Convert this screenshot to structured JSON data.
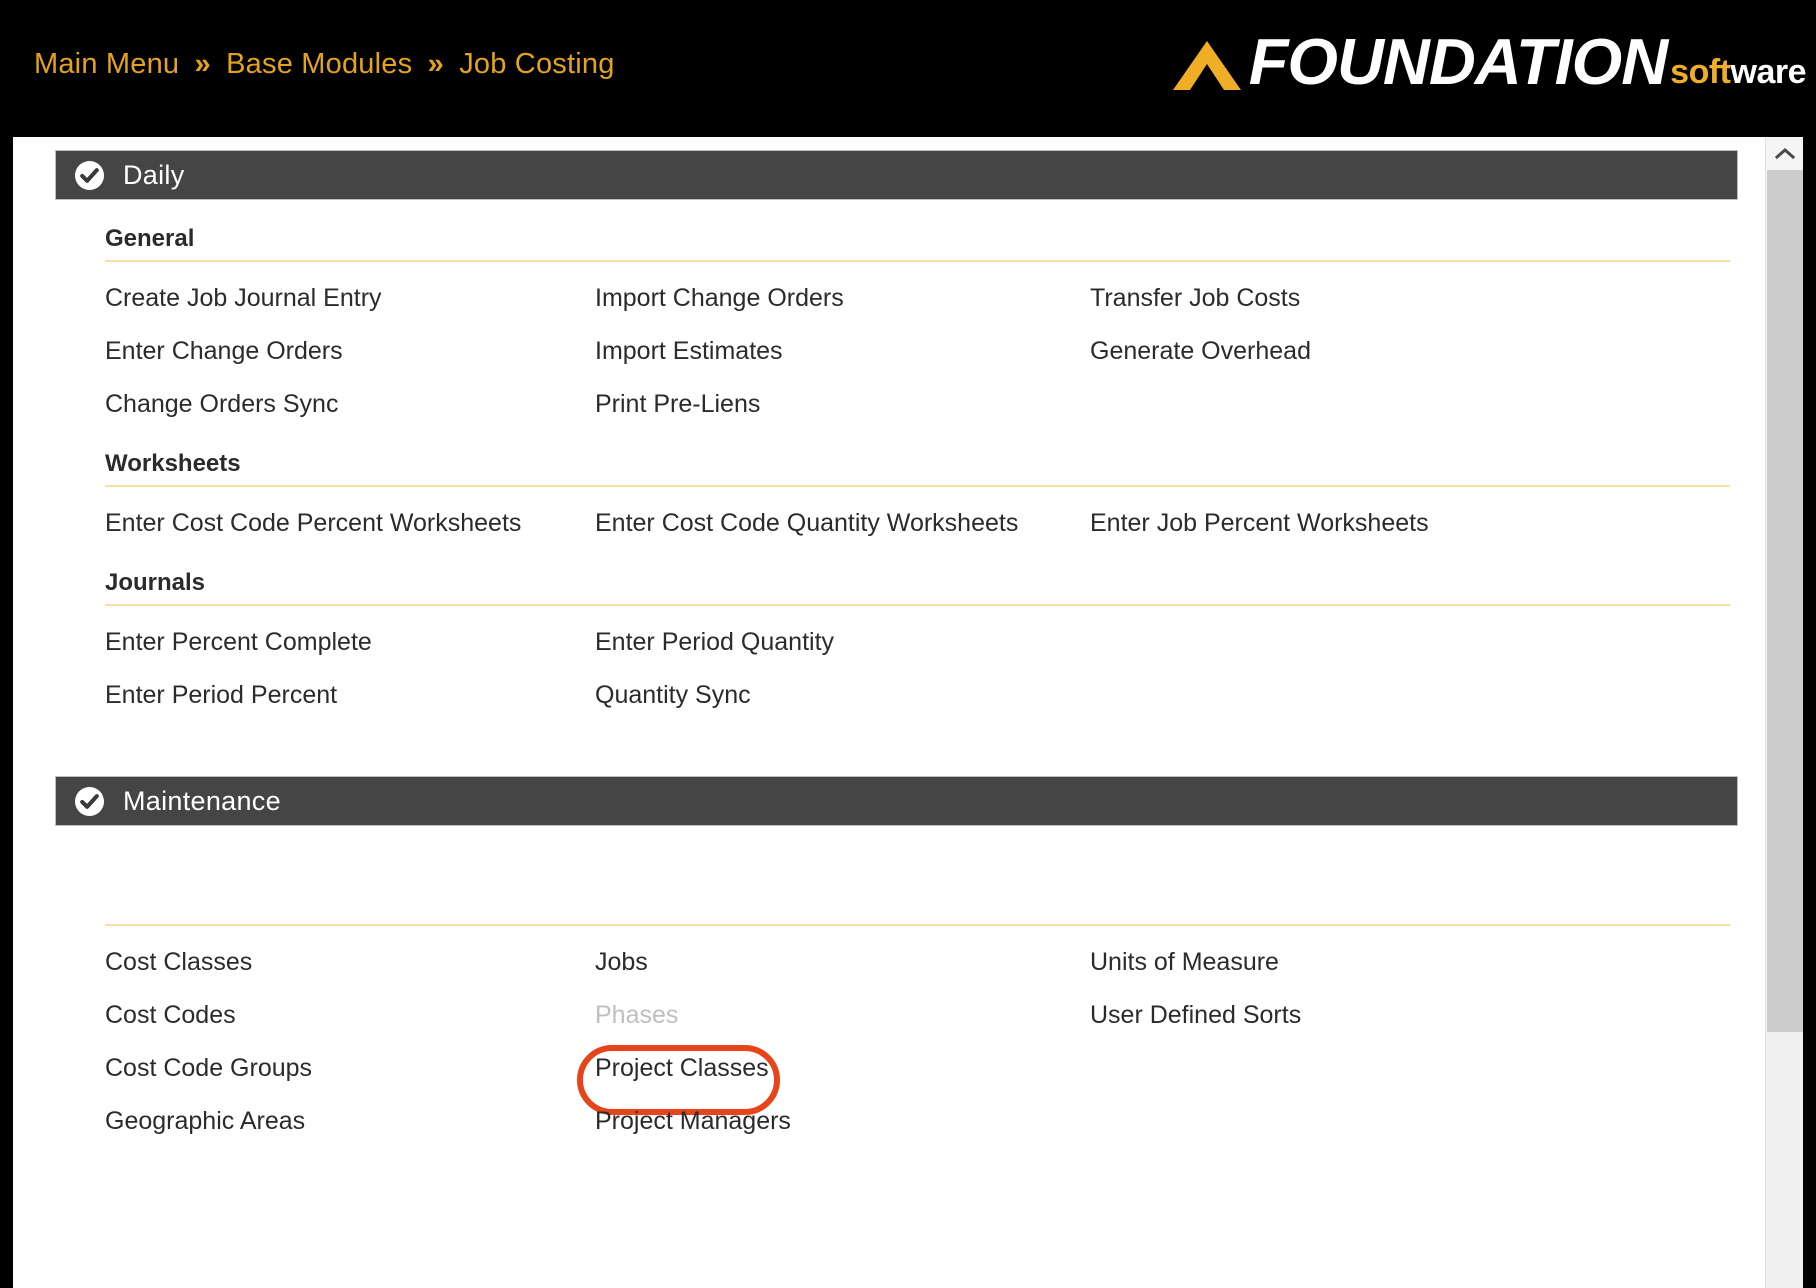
{
  "header": {
    "breadcrumb": [
      {
        "label": "Main Menu"
      },
      {
        "label": "Base Modules"
      },
      {
        "label": "Job Costing"
      }
    ],
    "separator": "»",
    "logo": {
      "word": "FOUNDATION",
      "suffix_bold": "soft",
      "suffix_light": "ware",
      "chevron_icon": "chevron-up-icon"
    },
    "colors": {
      "breadcrumb_text": "#E3A31B",
      "bar_background": "#000000",
      "logo_accent": "#F0AE27"
    }
  },
  "scrollbar": {
    "up_arrow_icon": "chevron-up-icon",
    "thumb_color": "#CDCDCD",
    "track_color": "#F0F0F0"
  },
  "sections": [
    {
      "id": "daily",
      "title": "Daily",
      "icon": "check-circle-icon",
      "groups": [
        {
          "title": "General",
          "rows": [
            [
              "Create Job Journal Entry",
              "Import Change Orders",
              "Transfer Job Costs"
            ],
            [
              "Enter Change Orders",
              "Import Estimates",
              "Generate Overhead"
            ],
            [
              "Change Orders Sync",
              "Print Pre-Liens",
              ""
            ]
          ]
        },
        {
          "title": "Worksheets",
          "rows": [
            [
              "Enter Cost Code Percent Worksheets",
              "Enter Cost Code Quantity Worksheets",
              "Enter Job Percent Worksheets"
            ]
          ]
        },
        {
          "title": "Journals",
          "rows": [
            [
              "Enter Percent Complete",
              "Enter Period Quantity",
              ""
            ],
            [
              "Enter Period Percent",
              "Quantity Sync",
              ""
            ]
          ]
        }
      ]
    },
    {
      "id": "maintenance",
      "title": "Maintenance",
      "icon": "check-circle-icon",
      "groups": [
        {
          "title": "",
          "rows": [
            [
              "Cost Classes",
              "Jobs",
              "Units of Measure"
            ],
            [
              "Cost Codes",
              "Phases",
              "User Defined Sorts"
            ],
            [
              "Cost Code Groups",
              "Project Classes",
              ""
            ],
            [
              "Geographic Areas",
              "Project Managers",
              ""
            ]
          ]
        }
      ]
    }
  ],
  "states": {
    "disabled_items": [
      "Phases"
    ],
    "highlighted_item": "Project Classes",
    "highlight_color": "#E8441B"
  }
}
